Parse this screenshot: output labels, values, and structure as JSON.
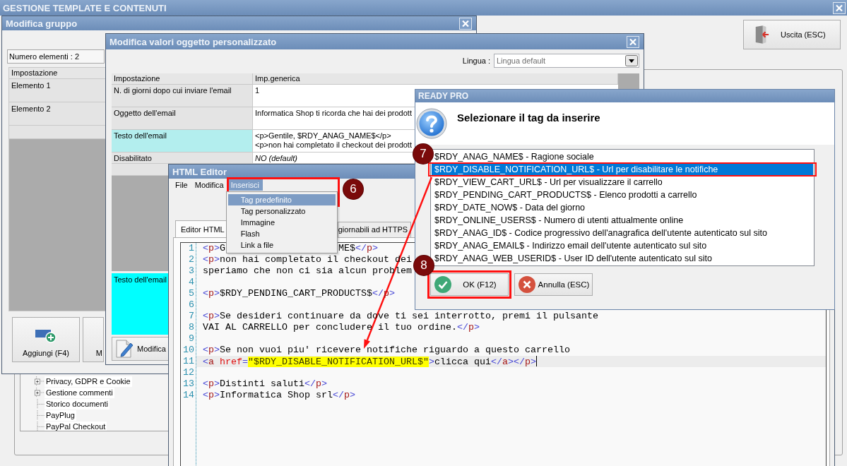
{
  "main_window": {
    "title": "GESTIONE TEMPLATE E CONTENUTI",
    "exit_button": "Uscita (ESC)",
    "tree": [
      {
        "label": "Privacy, GDPR e Cookie",
        "kind": "collapsed"
      },
      {
        "label": "Gestione commenti",
        "kind": "collapsed"
      },
      {
        "label": "Storico documenti",
        "kind": "leaf"
      },
      {
        "label": "PayPlug",
        "kind": "leaf"
      },
      {
        "label": "PayPal Checkout",
        "kind": "leaf"
      }
    ]
  },
  "group_window": {
    "title": "Modifica gruppo",
    "count_field": "Numero elementi : 2",
    "table": {
      "columns": [
        "Impostazione"
      ],
      "rows": [
        "Elemento 1",
        "Elemento 2"
      ]
    },
    "buttons": [
      {
        "label": "Aggiungi (F4)",
        "kind": "add"
      },
      {
        "label": "M",
        "kind": "partial"
      }
    ]
  },
  "values_window": {
    "title": "Modifica valori oggetto personalizzato",
    "language_label": "Lingua :",
    "language_value": "Lingua default",
    "table": {
      "columns": [
        "Impostazione",
        "Imp.generica"
      ],
      "rows": [
        {
          "setting": "N. di giorni dopo cui inviare l'email",
          "value": [
            "1"
          ],
          "selected": false,
          "default": false
        },
        {
          "setting": "Oggetto dell'email",
          "value": [
            "Informatica Shop ti ricorda che hai dei prodott"
          ],
          "selected": false,
          "default": false
        },
        {
          "setting": "Testo dell'email",
          "value": [
            "<p>Gentile, $RDY_ANAG_NAME$</p>",
            "<p>non hai completato il checkout dei prodott"
          ],
          "selected": true,
          "default": false
        },
        {
          "setting": "Disabilitato",
          "value": [
            "NO (default)"
          ],
          "selected": false,
          "default": true
        }
      ]
    },
    "preview_label": "Testo dell'email",
    "edit_button": "Modifica"
  },
  "html_editor": {
    "title": "HTML Editor",
    "menu": [
      {
        "label": "File",
        "selected": false
      },
      {
        "label": "Modifica",
        "selected": false
      },
      {
        "label": "Inserisci",
        "selected": true
      }
    ],
    "menu_items": [
      {
        "label": "Tag predefinito",
        "selected": true
      },
      {
        "label": "Tag personalizzato",
        "selected": false
      },
      {
        "label": "Immagine",
        "selected": false
      },
      {
        "label": "Flash",
        "selected": false
      },
      {
        "label": "Link a file",
        "selected": false
      }
    ],
    "tabs": [
      {
        "label": "Editor HTML",
        "selected": true
      },
      {
        "label": "giornabili ad HTTPS",
        "selected": false
      }
    ],
    "code": [
      {
        "number": "1",
        "current": false,
        "tokens": [
          {
            "kind": "tag",
            "text": "<p>"
          },
          {
            "kind": "text",
            "text": "G"
          },
          {
            "kind": "resume",
            "text": "ME$"
          },
          {
            "kind": "tag",
            "text": "</p>"
          }
        ]
      },
      {
        "number": "2",
        "current": false,
        "tokens": [
          {
            "kind": "tag",
            "text": "<p>"
          },
          {
            "kind": "text",
            "text": "non hai completato il checkout dei"
          }
        ]
      },
      {
        "number": "3",
        "current": false,
        "tokens": [
          {
            "kind": "text",
            "text": "speriamo che non ci sia alcun problem"
          }
        ]
      },
      {
        "number": "4",
        "current": false
      },
      {
        "number": "5",
        "current": false,
        "tokens": [
          {
            "kind": "tag",
            "text": "<p>"
          },
          {
            "kind": "text",
            "text": "$RDY_PENDING_CART_PRODUCTS$"
          },
          {
            "kind": "tag",
            "text": "</p>"
          }
        ]
      },
      {
        "number": "6",
        "current": false
      },
      {
        "number": "7",
        "current": false,
        "tokens": [
          {
            "kind": "tag",
            "text": "<p>"
          },
          {
            "kind": "text",
            "text": "Se desideri continuare da dove ti sei interrotto, premi il pulsante"
          }
        ]
      },
      {
        "number": "8",
        "current": false,
        "tokens": [
          {
            "kind": "text",
            "text": "VAI AL CARRELLO per concludere il tuo ordine."
          },
          {
            "kind": "tag",
            "text": "</p>"
          }
        ]
      },
      {
        "number": "9",
        "current": false
      },
      {
        "number": "10",
        "current": false,
        "tokens": [
          {
            "kind": "tag",
            "text": "<p>"
          },
          {
            "kind": "text",
            "text": "Se non vuoi piu' ricevere notifiche riguardo a questo carrello"
          }
        ]
      },
      {
        "number": "11",
        "current": true,
        "tokens": [
          {
            "kind": "tag",
            "text": "<a"
          },
          {
            "kind": "attr",
            "text": " href"
          },
          {
            "kind": "punct",
            "text": "="
          },
          {
            "kind": "str",
            "text": "\"$RDY_DISABLE_NOTIFICATION_URL$\""
          },
          {
            "kind": "punct",
            "text": ">"
          },
          {
            "kind": "text",
            "text": "clicca qui"
          },
          {
            "kind": "tag",
            "text": "</a></p>"
          }
        ]
      },
      {
        "number": "12",
        "current": false
      },
      {
        "number": "13",
        "current": false,
        "tokens": [
          {
            "kind": "tag",
            "text": "<p>"
          },
          {
            "kind": "text",
            "text": "Distinti saluti"
          },
          {
            "kind": "tag",
            "text": "</p>"
          }
        ]
      },
      {
        "number": "14",
        "current": false,
        "tokens": [
          {
            "kind": "tag",
            "text": "<p>"
          },
          {
            "kind": "text",
            "text": "Informatica Shop srl"
          },
          {
            "kind": "tag",
            "text": "</p>"
          }
        ]
      }
    ]
  },
  "dialog": {
    "title": "READY PRO",
    "prompt": "Selezionare il tag da inserire",
    "options": [
      {
        "label": "$RDY_ANAG_NAME$ - Ragione sociale",
        "selected": false
      },
      {
        "label": "$RDY_DISABLE_NOTIFICATION_URL$ - Url per disabilitare le notifiche",
        "selected": true
      },
      {
        "label": "$RDY_VIEW_CART_URL$ - Url per visualizzare il carrello",
        "selected": false
      },
      {
        "label": "$RDY_PENDING_CART_PRODUCTS$ - Elenco prodotti a carrello",
        "selected": false
      },
      {
        "label": "$RDY_DATE_NOW$ - Data del giorno",
        "selected": false
      },
      {
        "label": "$RDY_ONLINE_USERS$ - Numero di utenti attualmente online",
        "selected": false
      },
      {
        "label": "$RDY_ANAG_ID$ - Codice progressivo dell'anagrafica dell'utente autenticato sul sito",
        "selected": false
      },
      {
        "label": "$RDY_ANAG_EMAIL$ - Indirizzo email dell'utente autenticato sul sito",
        "selected": false
      },
      {
        "label": "$RDY_ANAG_WEB_USERID$ - User ID dell'utente autenticato sul sito",
        "selected": false
      }
    ],
    "buttons": [
      {
        "label": "OK (F12)",
        "kind": "ok"
      },
      {
        "label": "Annulla (ESC)",
        "kind": "cancel"
      }
    ]
  },
  "annotations": [
    "6",
    "7",
    "8"
  ]
}
